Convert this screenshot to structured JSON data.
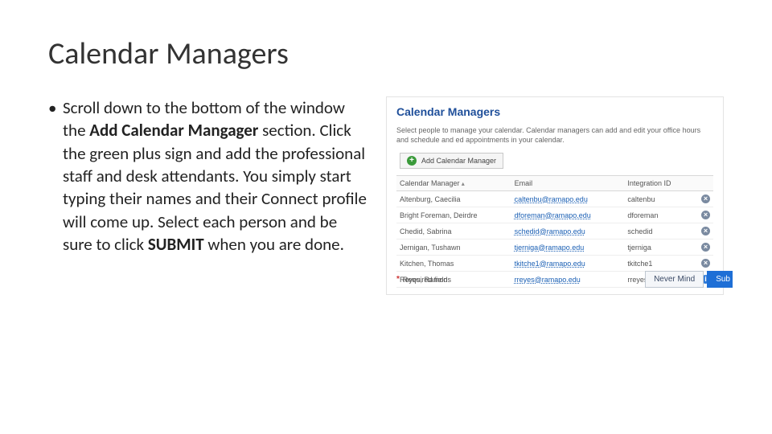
{
  "title": "Calendar Managers",
  "bullet": {
    "lead": "Scroll down to the bottom of the window the ",
    "bold1": "Add Calendar Mangager",
    "mid": " section.  Click the green plus sign and add the professional staff and desk attendants. You simply start typing their names and their Connect profile will come up. Select each person and be sure to click ",
    "bold2": "SUBMIT",
    "tail": " when you are done."
  },
  "panel": {
    "heading": "Calendar Managers",
    "description": "Select people to manage your calendar. Calendar managers can add and edit your office hours and schedule and ed appointments in your calendar.",
    "add_label": "Add Calendar Manager",
    "columns": {
      "name": "Calendar Manager",
      "email": "Email",
      "integration": "Integration ID"
    },
    "rows": [
      {
        "name": "Altenburg, Caecilia",
        "email": "caltenbu@ramapo.edu",
        "integration": "caltenbu",
        "kind": "del"
      },
      {
        "name": "Bright Foreman, Deirdre",
        "email": "dforeman@ramapo.edu",
        "integration": "dforeman",
        "kind": "del"
      },
      {
        "name": "Chedid, Sabrina",
        "email": "schedid@ramapo.edu",
        "integration": "schedid",
        "kind": "del"
      },
      {
        "name": "Jernigan, Tushawn",
        "email": "tjerniga@ramapo.edu",
        "integration": "tjerniga",
        "kind": "del"
      },
      {
        "name": "Kitchen, Thomas",
        "email": "tkitche1@ramapo.edu",
        "integration": "tkitche1",
        "kind": "del"
      },
      {
        "name": "Reyes, Ramon",
        "email": "rreyes@ramapo.edu",
        "integration": "rreyes",
        "kind": "info"
      }
    ],
    "required_label": "Required fields",
    "nevermind_label": "Never Mind",
    "submit_label": "Sub"
  }
}
